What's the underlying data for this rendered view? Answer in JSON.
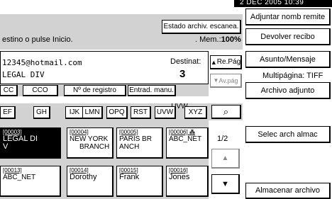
{
  "status_bar": {
    "datetime": "2 DEC  2005 10:39"
  },
  "header": {
    "hint": "estino o pulse Inicio.",
    "scan_status_button": "Estado archiv. escanea.",
    "memory_label": ". Mem.:",
    "memory_value": "100%"
  },
  "destination": {
    "email": "12345@hotmail.com",
    "name": "LEGAL DIV",
    "count_label": "Destinat:",
    "count": "3",
    "prev_page": "Re.Pág",
    "next_page": "Av.pág"
  },
  "address_tabs": [
    "CC",
    "CCO",
    "Nº de registro",
    "Entrad. manu."
  ],
  "index_keys": [
    "EF",
    "GH",
    "IJK",
    "LMN",
    "OPQ",
    "RST",
    "UVW",
    "XYZ"
  ],
  "search_icon": "search-icon",
  "page_indicator": "1/2",
  "entries": [
    {
      "code": "[00003]",
      "lines": [
        "LEGAL DI",
        "V"
      ],
      "selected": true
    },
    {
      "code": "[00004]",
      "lines": [
        "NEW YORK",
        "BRANCH"
      ],
      "selected": false
    },
    {
      "code": "[00005]",
      "lines": [
        "PARIS BR",
        "ANCH"
      ],
      "selected": false
    },
    {
      "code": "[00006]",
      "lines": [
        "ABC_NET",
        ""
      ],
      "selected": false,
      "group_mark": "⁂"
    },
    {
      "code": "[00013]",
      "lines": [
        "ABC_NET",
        ""
      ],
      "selected": false
    },
    {
      "code": "[00014]",
      "lines": [
        "Dorothy",
        ""
      ],
      "selected": false
    },
    {
      "code": "[00015]",
      "lines": [
        "Frank",
        ""
      ],
      "selected": false
    },
    {
      "code": "[00016]",
      "lines": [
        "Jones",
        ""
      ],
      "selected": false
    }
  ],
  "right_panel": {
    "attach_sender_name": "Adjuntar nomb remite",
    "return_receipt": "Devolver recibo",
    "subject_message": "Asunto/Mensaje",
    "multipage_label": "Multipágina: TIFF",
    "attached_file": "Archivo adjunto",
    "select_stored_file": "Selec arch almac",
    "store_file": "Almacenar archivo"
  }
}
